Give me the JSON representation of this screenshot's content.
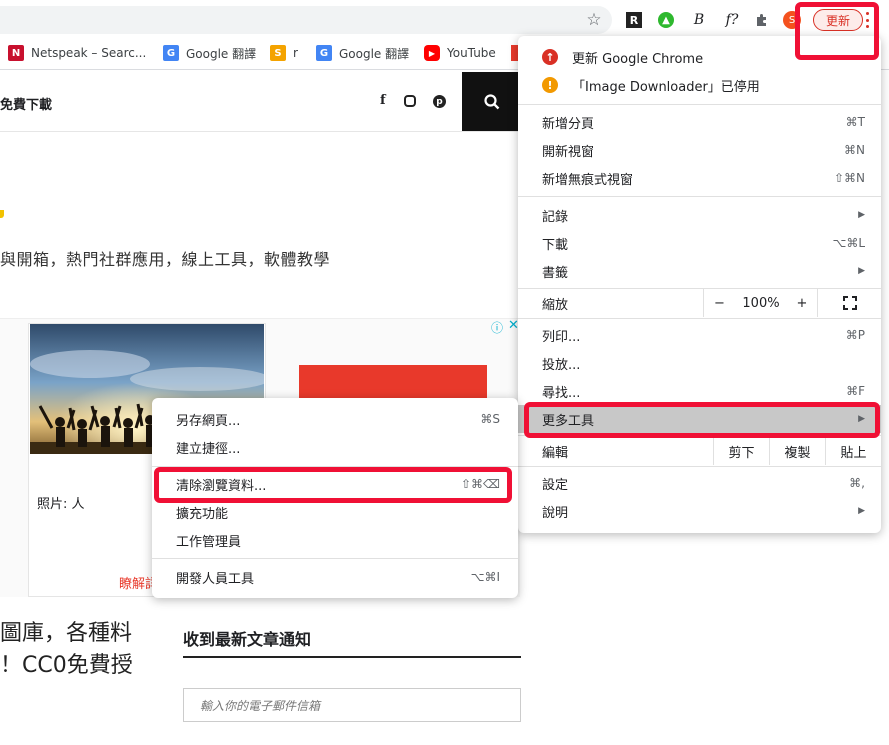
{
  "toolbar": {
    "update_label": "更新",
    "icons": [
      "star-icon",
      "r-extension-icon",
      "green-extension-icon",
      "b-extension-icon",
      "f-extension-icon",
      "puzzle-icon",
      "profile-avatar",
      "menu-dots-icon"
    ],
    "profile_initial": "S",
    "ext_r": "R",
    "ext_b": "B",
    "ext_f": "f?"
  },
  "bookmarks": [
    {
      "label": "Netspeak – Searc...",
      "icon": "N",
      "color": "#c8102e"
    },
    {
      "label": "Google 翻譯",
      "icon": "G",
      "color": "#4285f4"
    },
    {
      "label": "r",
      "icon": "S",
      "color": "#f4a300"
    },
    {
      "label": "Google 翻譯",
      "icon": "G",
      "color": "#4285f4"
    },
    {
      "label": "YouTube",
      "icon": "▶",
      "color": "#ff0000"
    }
  ],
  "site": {
    "title": "免費下載",
    "description": "與開箱，熱門社群應用，線上工具，軟體教學",
    "ad_caption": "照片: 人",
    "ad_link": "瞭解詳",
    "big_heading": "圖庫，各種料\n！CC0免費授",
    "notify_title": "收到最新文章通知",
    "email_placeholder": "輸入你的電子郵件信箱"
  },
  "chrome_menu": {
    "update_item": "更新 Google Chrome",
    "ext_disabled": "「Image Downloader」已停用",
    "new_tab": "新增分頁",
    "new_tab_sc": "⌘T",
    "new_window": "開新視窗",
    "new_window_sc": "⌘N",
    "incognito": "新增無痕式視窗",
    "incognito_sc": "⇧⌘N",
    "history": "記錄",
    "downloads": "下載",
    "downloads_sc": "⌥⌘L",
    "bookmarks": "書籤",
    "zoom_label": "縮放",
    "zoom_minus": "−",
    "zoom_value": "100%",
    "zoom_plus": "+",
    "print": "列印...",
    "print_sc": "⌘P",
    "cast": "投放...",
    "find": "尋找...",
    "find_sc": "⌘F",
    "more_tools": "更多工具",
    "edit": "編輯",
    "cut": "剪下",
    "copy": "複製",
    "paste": "貼上",
    "settings": "設定",
    "settings_sc": "⌘,",
    "help": "說明"
  },
  "sub_menu": {
    "save_page": "另存網頁...",
    "save_page_sc": "⌘S",
    "create_shortcut": "建立捷徑...",
    "clear_data": "清除瀏覽資料...",
    "clear_data_sc": "⇧⌘⌫",
    "extensions": "擴充功能",
    "task_manager": "工作管理員",
    "dev_tools": "開發人員工具",
    "dev_tools_sc": "⌥⌘I"
  },
  "colors": {
    "highlight": "#f01035",
    "hover": "#c8c8c8",
    "update_red": "#d93025",
    "warning_orange": "#f29900"
  }
}
